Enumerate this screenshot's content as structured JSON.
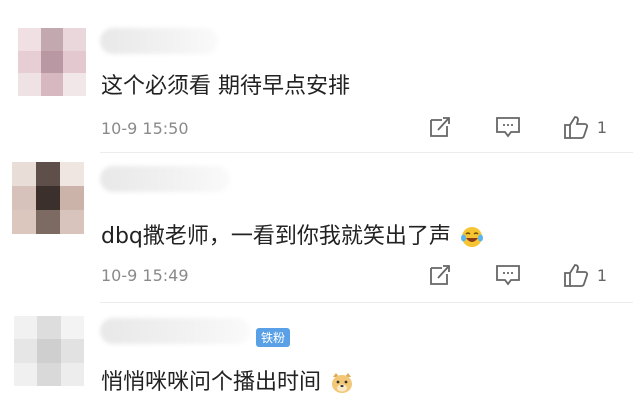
{
  "comments": [
    {
      "text": "这个必须看  期待早点安排",
      "time": "10-9 15:50",
      "likes": "1"
    },
    {
      "text": "dbq撒老师，一看到你我就笑出了声",
      "time": "10-9 15:49",
      "likes": "1"
    },
    {
      "text": "悄悄咪咪问个播出时间",
      "badge": "铁粉"
    }
  ],
  "icons": {
    "edit": "edit-icon",
    "reply": "comment-icon",
    "like": "thumb-up-icon"
  },
  "colors": {
    "badge": "#5aa0e6",
    "time": "#8a8a8a"
  }
}
